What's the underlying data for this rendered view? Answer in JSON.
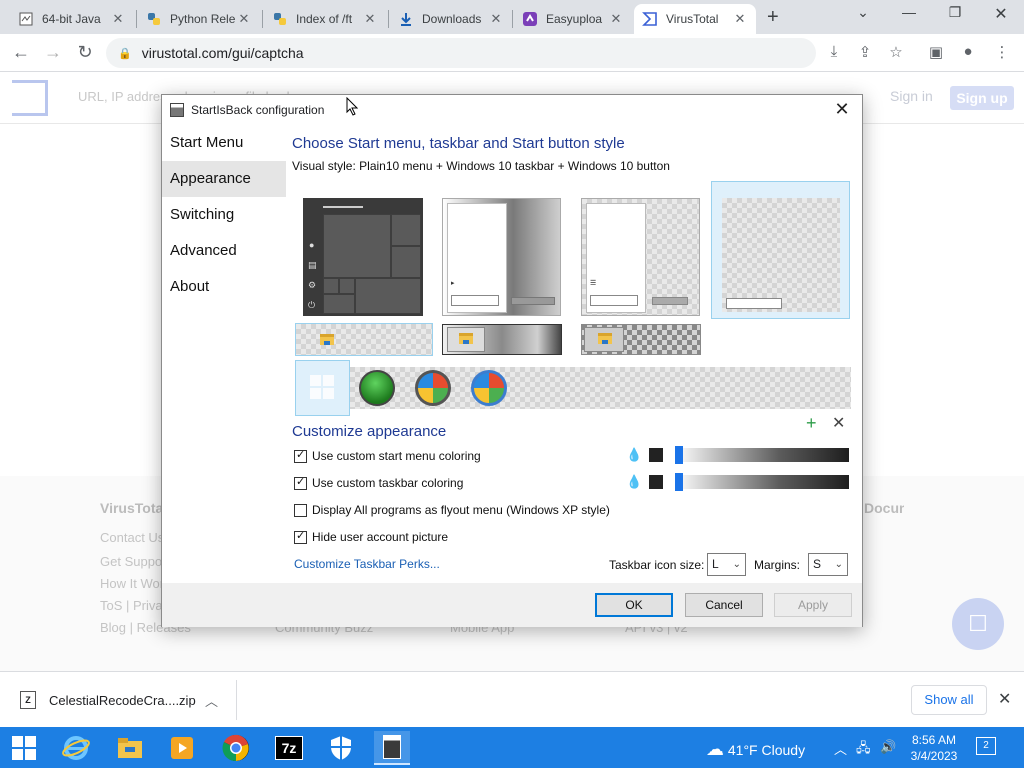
{
  "browser": {
    "tabs": [
      {
        "title": "64-bit Java",
        "icon": "document-icon",
        "active": false
      },
      {
        "title": "Python Rele",
        "icon": "python-icon",
        "active": false
      },
      {
        "title": "Index of /ft",
        "icon": "python-icon",
        "active": false
      },
      {
        "title": "Downloads",
        "icon": "download-icon",
        "active": false
      },
      {
        "title": "Easyuploa",
        "icon": "easyupload-icon",
        "active": false
      },
      {
        "title": "VirusTotal",
        "icon": "virustotal-icon",
        "active": true
      }
    ],
    "url": "virustotal.com/gui/captcha"
  },
  "vt": {
    "search_placeholder": "URL, IP address, domain, or file hash",
    "sign_in": "Sign in",
    "sign_up": "Sign up",
    "footer": {
      "col1_title": "VirusTotal",
      "col1": [
        "Contact Us",
        "Get Support",
        "How It Works",
        "ToS | Privacy Notice",
        "Blog | Releases"
      ],
      "col2": "Community Buzz",
      "col3": "Mobile App",
      "col4": "API v3 | v2",
      "col4_title": "Documentation"
    }
  },
  "dialog": {
    "title": "StartIsBack configuration",
    "nav": [
      "Start Menu",
      "Appearance",
      "Switching",
      "Advanced",
      "About"
    ],
    "selected_nav": "Appearance",
    "heading": "Choose Start menu, taskbar and Start button style",
    "visual_style": "Visual style:  Plain10 menu + Windows 10 taskbar + Windows 10 button",
    "customize_heading": "Customize appearance",
    "options": [
      {
        "label": "Use custom start menu coloring",
        "checked": true
      },
      {
        "label": "Use custom taskbar coloring",
        "checked": true
      },
      {
        "label": "Display All programs as flyout menu (Windows XP style)",
        "checked": false
      },
      {
        "label": "Hide user account picture",
        "checked": true
      }
    ],
    "perks_link": "Customize Taskbar Perks...",
    "icon_size_label": "Taskbar icon size:",
    "icon_size_value": "L",
    "margins_label": "Margins:",
    "margins_value": "S",
    "ok": "OK",
    "cancel": "Cancel",
    "apply": "Apply"
  },
  "download": {
    "filename": "CelestialRecodeCra....zip",
    "show_all": "Show all"
  },
  "taskbar": {
    "weather": "41°F  Cloudy",
    "time": "8:56 AM",
    "date": "3/4/2023",
    "notification_count": "2"
  }
}
